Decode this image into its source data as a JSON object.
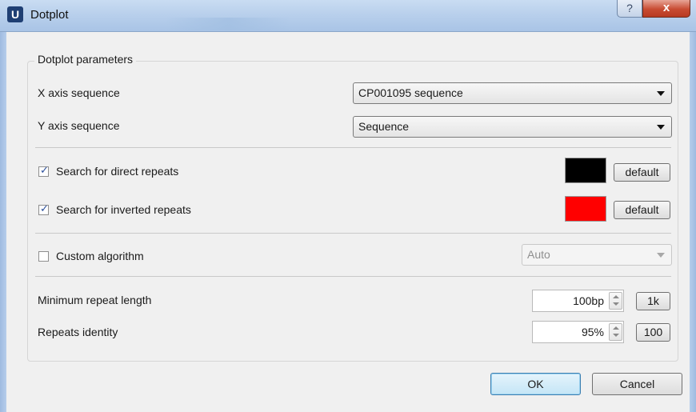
{
  "window": {
    "app_icon_letter": "U",
    "title": "Dotplot",
    "help_glyph": "?",
    "close_glyph": "x"
  },
  "group": {
    "title": "Dotplot parameters"
  },
  "x_axis": {
    "label": "X axis sequence",
    "value": "CP001095 sequence"
  },
  "y_axis": {
    "label": "Y axis sequence",
    "value": "Sequence"
  },
  "direct_repeats": {
    "label": "Search for direct repeats",
    "checked": true,
    "color": "#000000",
    "default_label": "default"
  },
  "inverted_repeats": {
    "label": "Search for inverted repeats",
    "checked": true,
    "color": "#ff0000",
    "default_label": "default"
  },
  "custom_algorithm": {
    "label": "Custom algorithm",
    "checked": false,
    "value": "Auto"
  },
  "min_repeat_length": {
    "label": "Minimum repeat length",
    "value": "100bp",
    "preset_label": "1k"
  },
  "repeats_identity": {
    "label": "Repeats  identity",
    "value": "95%",
    "preset_label": "100"
  },
  "buttons": {
    "ok": "OK",
    "cancel": "Cancel"
  },
  "checkmark": "✓"
}
